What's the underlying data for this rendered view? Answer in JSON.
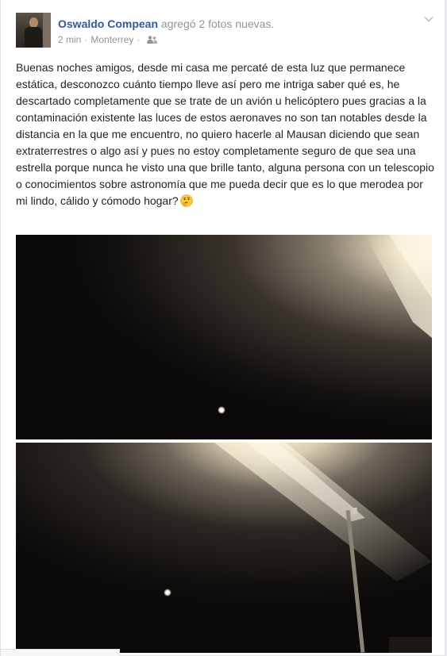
{
  "post": {
    "author": "Oswaldo Compean",
    "action": "agregó 2 fotos nuevas.",
    "time": "2 min",
    "location": "Monterrey",
    "separator": "·",
    "audience_icon": "friends-icon",
    "menu_icon": "chevron-down-icon",
    "text": "Buenas noches amigos, desde mi casa me percaté de esta luz que permanece estática, desconozco cuánto tiempo lleve así pero me intriga saber qué es, he descartado completamente que se trate de un avión u helicóptero pues gracias a la contaminación existente las luces de estos aeronaves no son tan notables desde la distancia en la que me encuentro, no quiero hacerle al Mausan diciendo que sean extraterrestres o algo así y pues no estoy completamente seguro de que sea una estrella porque nunca he visto una que brille tanto, alguna persona con un telescopio o conocimientos sobre astronomía que me pueda decir que es lo que merodea por mi lindo, cálido y cómodo hogar?",
    "emoji": "thinking-face-emoji"
  },
  "photos": [
    {
      "name": "night-sky-photo-1"
    },
    {
      "name": "night-sky-photo-2"
    }
  ],
  "colors": {
    "link": "#365899",
    "meta": "#90949c",
    "text": "#1d2129",
    "background": "#e9ebee"
  }
}
